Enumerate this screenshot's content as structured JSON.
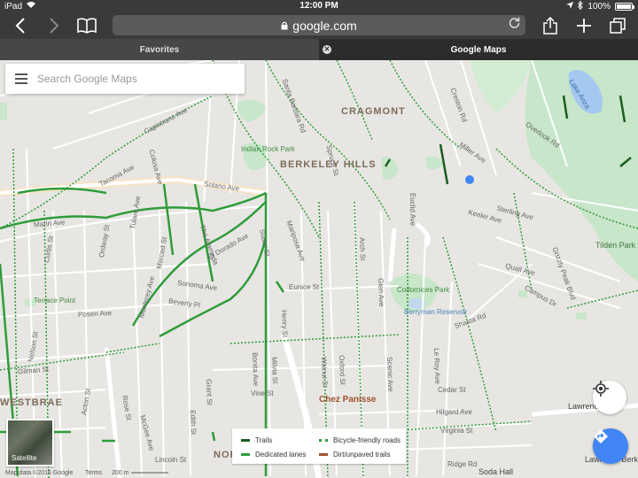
{
  "status_bar": {
    "device": "iPad",
    "time": "12:00 PM",
    "battery": "100%"
  },
  "toolbar": {
    "back_icon": "chevron-left-icon",
    "forward_icon": "chevron-right-icon",
    "bookmarks_icon": "open-book-icon",
    "address": "google.com",
    "lock_icon": "lock-icon",
    "reload_icon": "reload-icon",
    "share_icon": "share-icon",
    "new_tab_icon": "plus-icon",
    "tabs_icon": "tabs-icon"
  },
  "tabs": [
    {
      "label": "Favorites"
    },
    {
      "label": "Google Maps"
    }
  ],
  "search": {
    "placeholder": "Search Google Maps"
  },
  "map": {
    "areas": [
      "CRAGMONT",
      "BERKELEY HILLS",
      "WESTBRAE",
      "NORTH"
    ],
    "places": {
      "indian_rock": "Indian Rock Park",
      "codornices": "Codornices Park",
      "berryman": "Berryman Reservoir",
      "terrace": "Terrace Point",
      "chez": "Chez Panisse",
      "lake": "Lake Anza",
      "tilden": "Tilden Park",
      "lawrence": "Lawrence Hall",
      "lawrence2": "Lawrence Berke",
      "soda": "Soda Hall"
    },
    "streets": {
      "solano": "Solano Ave",
      "marin": "Marin Ave",
      "sonoma": "Sonoma Ave",
      "posen": "Posen Ave",
      "hopkins": "Hopkins St",
      "gilman": "Gilman St",
      "eunice": "Eunice St",
      "shasta": "Shasta Rd",
      "keeler": "Keeler Ave",
      "sterling": "Sterling Ave",
      "quail": "Quail Ave",
      "grizzly": "Grizzly Peak Blvd",
      "euclid": "Euclid Ave",
      "spruce": "Spruce St",
      "arch": "Arch St",
      "henry": "Henry St",
      "cedar": "Cedar St",
      "virginia": "Virginia St",
      "hilgard": "Hilgard Ave",
      "rose": "Rose St",
      "vine": "Vine St",
      "lincoln": "Lincoln St",
      "capistrano": "Capistrano Ave",
      "tacoma": "Tacoma Ave",
      "campus": "Campus Dr",
      "ridge": "Ridge Rd",
      "ordway": "Ordway St",
      "curtis": "Curtis St",
      "nelson": "Nelson St",
      "acton": "Acton St",
      "beverly": "Beverly Pl",
      "hilltop": "Los Angeles Ave",
      "el_dorado": "El Dorado Ave",
      "mariposa": "Mariposa Ave",
      "stannage": "Santa Barbara Rd",
      "miller": "Miller Ave",
      "overlook": "Overlook Rd",
      "creston": "Creston Rd",
      "glen": "Glen Ave",
      "scenic": "Scenic Ave",
      "leroy": "Le Roy Ave",
      "oxford": "Oxford St",
      "walnut": "Walnut St",
      "milvia": "Milvia St",
      "bonita": "Bonita Ave",
      "grant": "Grant St",
      "edith": "Edith St",
      "mckinley": "McGee Ave",
      "sacramento": "Sacramento St",
      "monterey": "Monterey Ave",
      "sutter": "Sutter St",
      "alameda": "The Alameda",
      "colusa": "Colusa Ave",
      "tulare": "Tulare Ave",
      "fresno": "Fresno Ave",
      "merced": "Merced St"
    }
  },
  "legend": {
    "trails": "Trails",
    "dedicated": "Dedicated lanes",
    "bike_friendly": "Bicycle-friendly roads",
    "dirt": "Dirt/unpaved trails",
    "colors": {
      "trails": "#1b5e20",
      "dedicated": "#2e9c3a",
      "bike_friendly": "#2e9c3a",
      "dirt": "#a0522d"
    }
  },
  "satellite": {
    "label": "Satellite"
  },
  "footer": {
    "data": "Map data ©2016 Google",
    "terms": "Terms",
    "scale": "200 m"
  },
  "controls": {
    "locate_icon": "my-location-icon",
    "directions_icon": "directions-icon"
  },
  "colors": {
    "accent": "#4285f4",
    "park": "#c8e6c9",
    "water": "#a4c8f0",
    "bike_green": "#2e9c3a"
  }
}
